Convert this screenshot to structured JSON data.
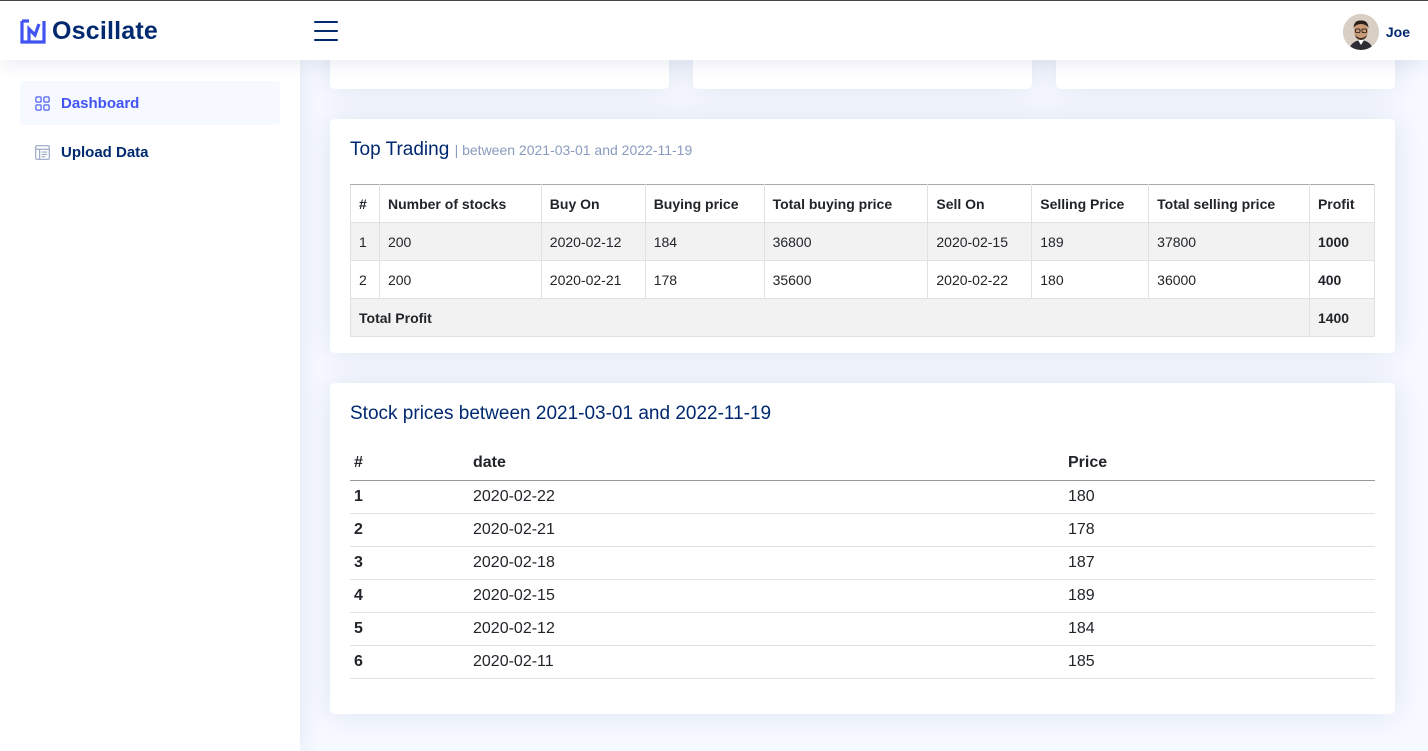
{
  "app": {
    "name": "Oscillate",
    "brand_color": "#4154f1",
    "text_color": "#012970"
  },
  "header": {
    "menu_icon": "hamburger-icon",
    "user_name": "Joe"
  },
  "sidebar": {
    "items": [
      {
        "label": "Dashboard",
        "icon": "grid-icon",
        "active": true
      },
      {
        "label": "Upload Data",
        "icon": "layout-text-icon",
        "active": false
      }
    ]
  },
  "top_trading": {
    "title": "Top Trading",
    "subtitle": "| between 2021-03-01 and 2022-11-19",
    "columns": [
      "#",
      "Number of stocks",
      "Buy On",
      "Buying price",
      "Total buying price",
      "Sell On",
      "Selling Price",
      "Total selling price",
      "Profit"
    ],
    "rows": [
      [
        "1",
        "200",
        "2020-02-12",
        "184",
        "36800",
        "2020-02-15",
        "189",
        "37800",
        "1000"
      ],
      [
        "2",
        "200",
        "2020-02-21",
        "178",
        "35600",
        "2020-02-22",
        "180",
        "36000",
        "400"
      ]
    ],
    "total_label": "Total Profit",
    "total_value": "1400"
  },
  "stock_prices": {
    "title": "Stock prices between 2021-03-01 and 2022-11-19",
    "columns": [
      "#",
      "date",
      "Price"
    ],
    "rows": [
      [
        "1",
        "2020-02-22",
        "180"
      ],
      [
        "2",
        "2020-02-21",
        "178"
      ],
      [
        "3",
        "2020-02-18",
        "187"
      ],
      [
        "4",
        "2020-02-15",
        "189"
      ],
      [
        "5",
        "2020-02-12",
        "184"
      ],
      [
        "6",
        "2020-02-11",
        "185"
      ]
    ]
  }
}
